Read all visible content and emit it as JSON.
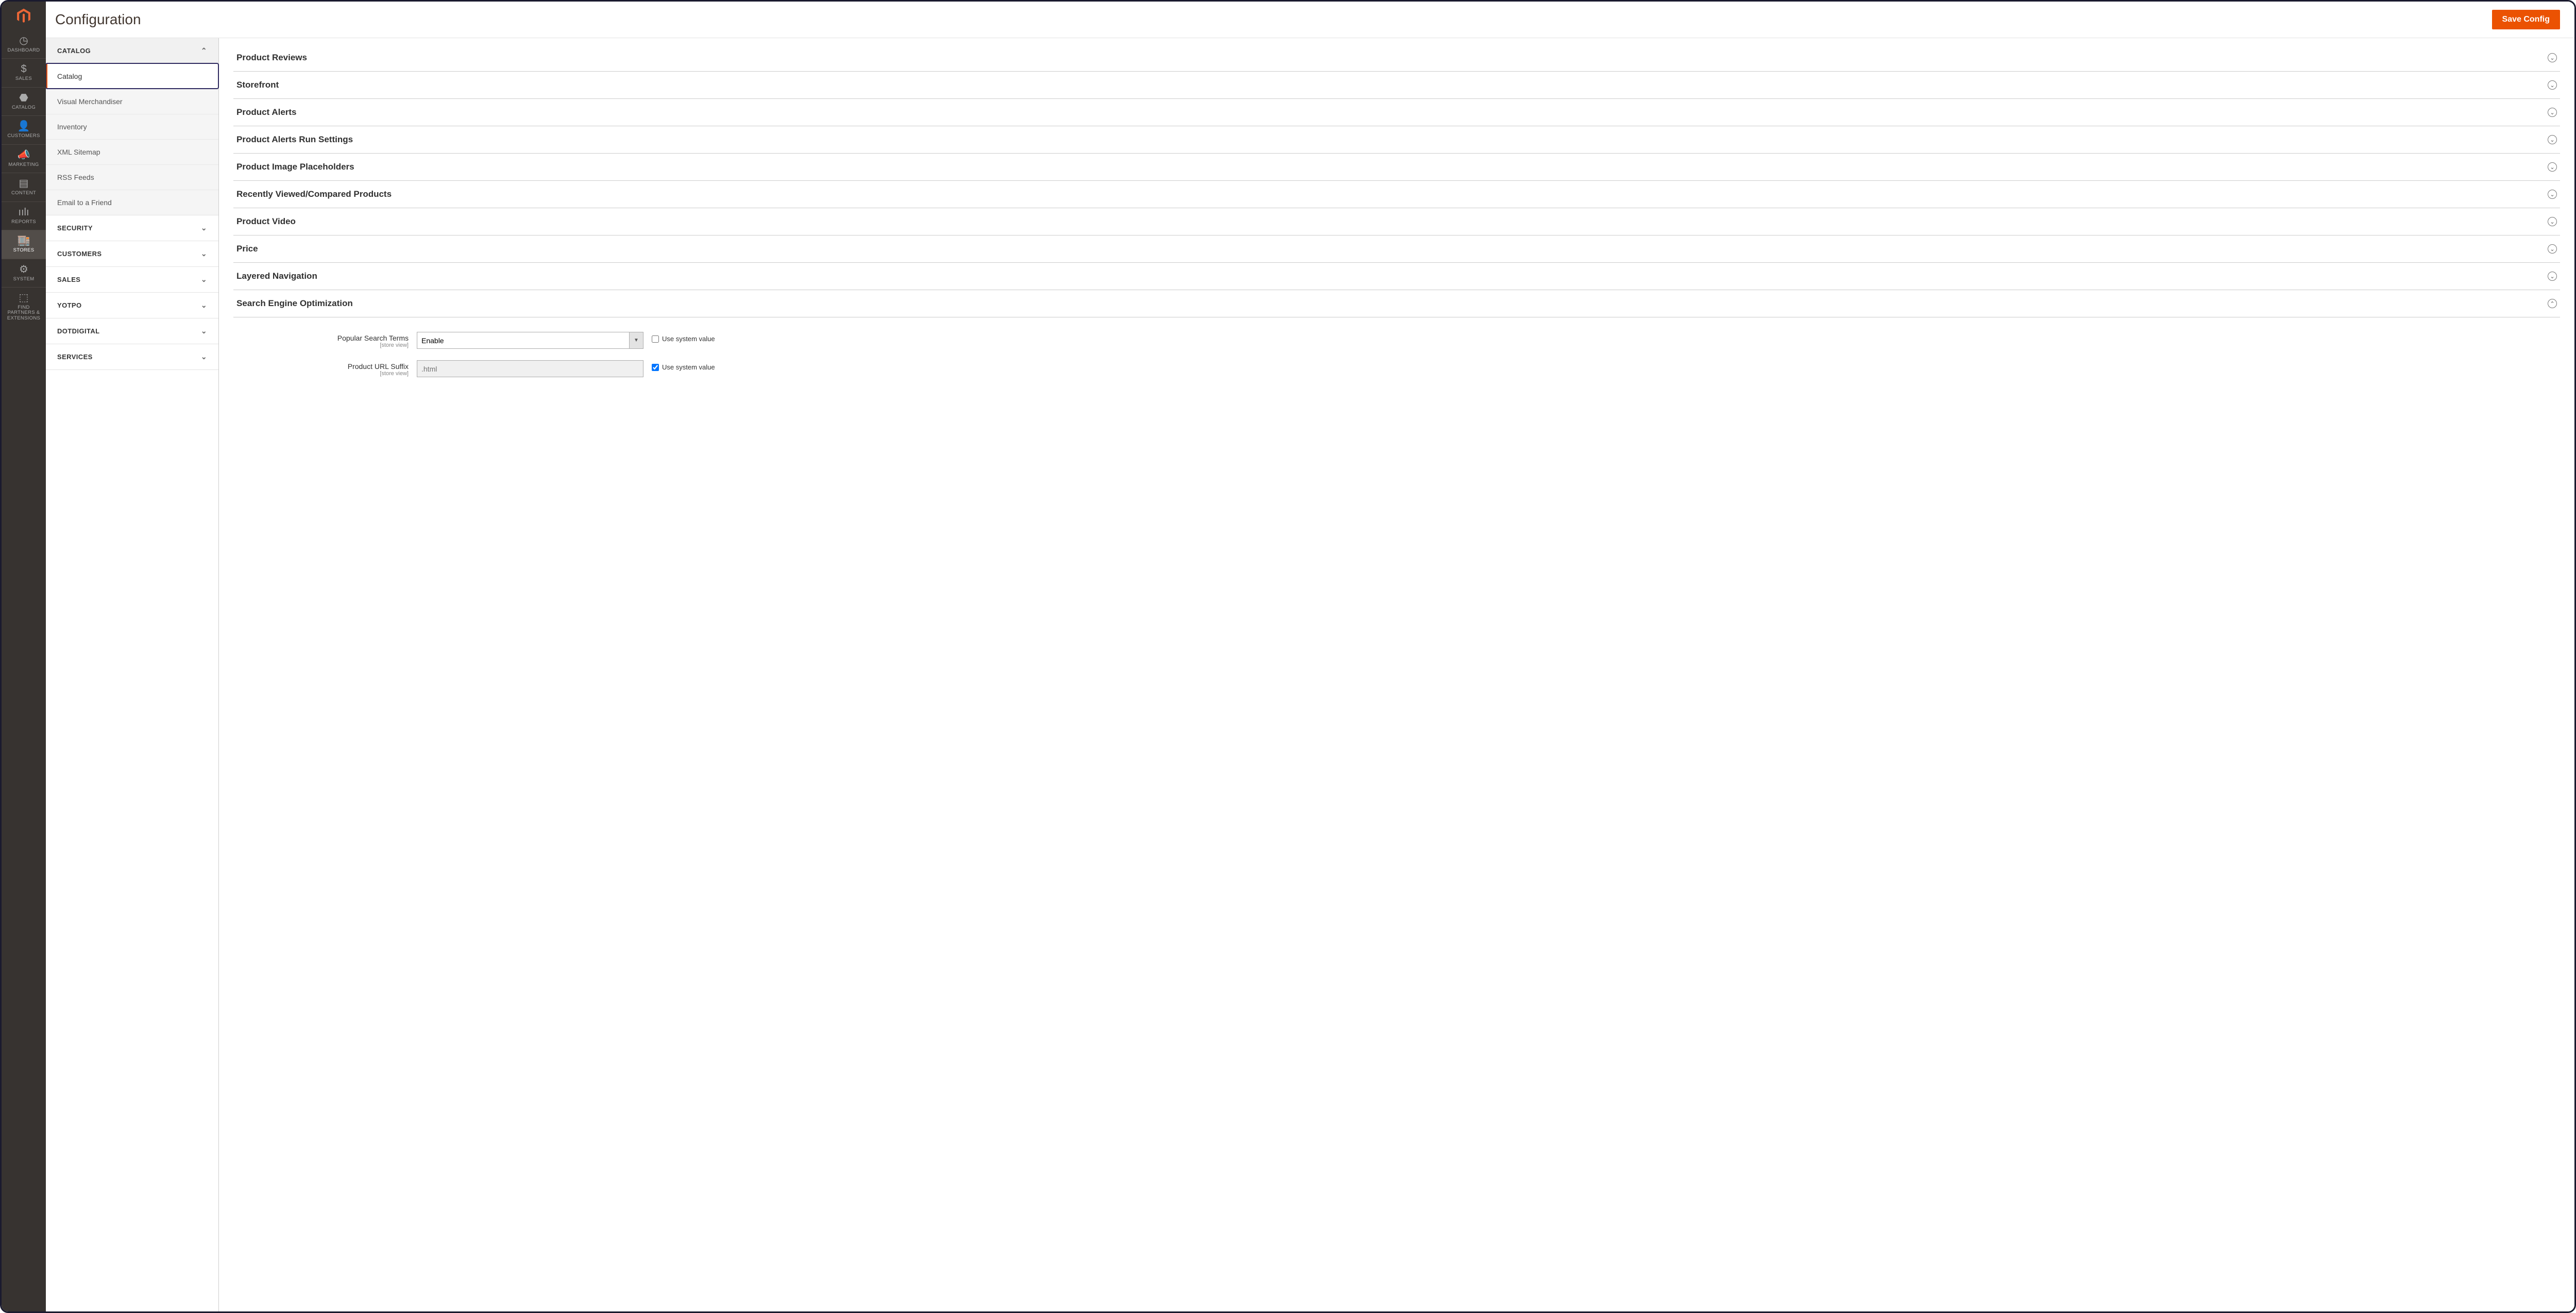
{
  "leftNav": {
    "items": [
      {
        "label": "Dashboard",
        "icon": "◷"
      },
      {
        "label": "Sales",
        "icon": "$"
      },
      {
        "label": "Catalog",
        "icon": "⬣"
      },
      {
        "label": "Customers",
        "icon": "👤"
      },
      {
        "label": "Marketing",
        "icon": "📣"
      },
      {
        "label": "Content",
        "icon": "▤"
      },
      {
        "label": "Reports",
        "icon": "ıılı"
      },
      {
        "label": "Stores",
        "icon": "🏬"
      },
      {
        "label": "System",
        "icon": "⚙"
      },
      {
        "label": "Find Partners & Extensions",
        "icon": "⬚"
      }
    ],
    "activeIndex": 7
  },
  "header": {
    "title": "Configuration",
    "saveLabel": "Save Config"
  },
  "configNav": {
    "sections": [
      {
        "label": "Catalog",
        "open": true,
        "items": [
          {
            "label": "Catalog",
            "active": true
          },
          {
            "label": "Visual Merchandiser"
          },
          {
            "label": "Inventory"
          },
          {
            "label": "XML Sitemap"
          },
          {
            "label": "RSS Feeds"
          },
          {
            "label": "Email to a Friend"
          }
        ]
      },
      {
        "label": "Security"
      },
      {
        "label": "Customers"
      },
      {
        "label": "Sales"
      },
      {
        "label": "Yotpo"
      },
      {
        "label": "dotdigital"
      },
      {
        "label": "Services"
      }
    ]
  },
  "accordion": [
    {
      "label": "Product Reviews",
      "open": false
    },
    {
      "label": "Storefront",
      "open": false
    },
    {
      "label": "Product Alerts",
      "open": false
    },
    {
      "label": "Product Alerts Run Settings",
      "open": false
    },
    {
      "label": "Product Image Placeholders",
      "open": false
    },
    {
      "label": "Recently Viewed/Compared Products",
      "open": false
    },
    {
      "label": "Product Video",
      "open": false
    },
    {
      "label": "Price",
      "open": false
    },
    {
      "label": "Layered Navigation",
      "open": false
    },
    {
      "label": "Search Engine Optimization",
      "open": true
    }
  ],
  "seo": {
    "fields": [
      {
        "label": "Popular Search Terms",
        "scope": "[store view]",
        "type": "select",
        "value": "Enable",
        "useSystem": false,
        "sysLabel": "Use system value"
      },
      {
        "label": "Product URL Suffix",
        "scope": "[store view]",
        "type": "text",
        "value": ".html",
        "disabled": true,
        "useSystem": true,
        "sysLabel": "Use system value"
      }
    ]
  },
  "colors": {
    "accent": "#eb5202",
    "navBg": "#373330"
  }
}
